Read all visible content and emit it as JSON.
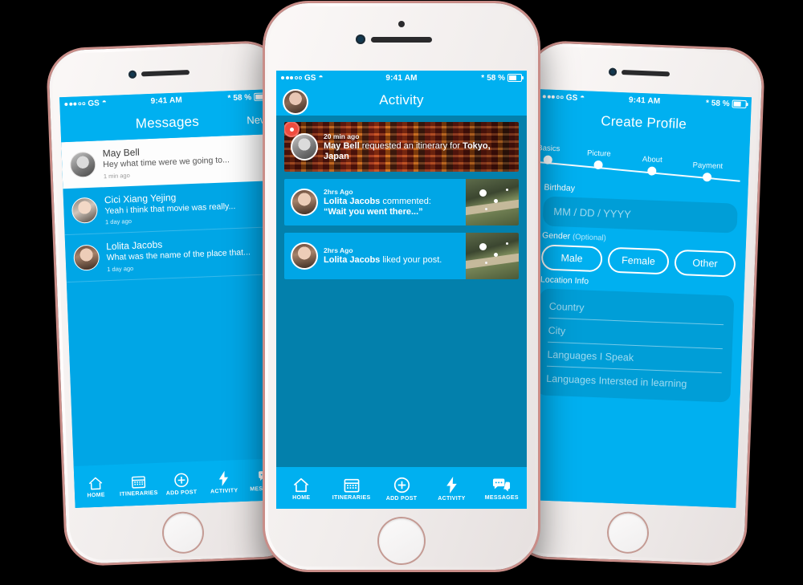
{
  "app": {
    "accent_blue": "#00B0F0",
    "body_blue": "#0380AC",
    "card_blue": "#00A6E6",
    "notification_red": "#F04B3E",
    "phone_body": "#F4F0EF",
    "phone_edge": "#C98D88",
    "page_background": "#000000"
  },
  "status_bar": {
    "carrier": "GS",
    "time": "9:41 AM",
    "battery": "58 %",
    "wifi_icon": "wifi-icon",
    "bluetooth_icon": "bluetooth-icon",
    "signal_icon": "signal-dots-icon",
    "battery_icon": "battery-icon"
  },
  "left_phone": {
    "screen_name": "Messages",
    "header": {
      "title": "Messages",
      "action": "New"
    },
    "conversations": [
      {
        "name": "May Bell",
        "preview": "Hey what time were we going to...",
        "time": "1 min ago",
        "unread": true
      },
      {
        "name": "Cici Xiang Yejing",
        "preview": "Yeah i think that movie was really...",
        "time": "1 day ago",
        "unread": false
      },
      {
        "name": "Lolita Jacobs",
        "preview": "What was the name of the place that...",
        "time": "1 day ago",
        "unread": false
      }
    ],
    "tabs": [
      {
        "label": "HOME",
        "icon": "home-icon"
      },
      {
        "label": "ITINERARIES",
        "icon": "calendar-icon"
      },
      {
        "label": "ADD POST",
        "icon": "plus-circle-icon"
      },
      {
        "label": "ACTIVITY",
        "icon": "lightning-bolt-icon"
      },
      {
        "label": "MESSAGES",
        "icon": "chat-bubble-icon"
      }
    ]
  },
  "center_phone": {
    "screen_name": "Activity",
    "header": {
      "title": "Activity",
      "avatar": "user-avatar"
    },
    "feed": [
      {
        "time": "20 min ago",
        "actor": "May Bell",
        "action": " requested an itinerary for ",
        "target": "Tokyo, Japan",
        "has_unread_badge": true,
        "style": "hero",
        "background_image": "tokyo-street-photo"
      },
      {
        "time": "2hrs Ago",
        "actor": "Lolita Jacobs",
        "action": " commented:",
        "quote": "“Wait you went there...”",
        "style": "plain",
        "thumbnail": "landscape-photo"
      },
      {
        "time": "2hrs Ago",
        "actor": "Lolita Jacobs",
        "action": " liked your post.",
        "style": "plain",
        "thumbnail": "landscape-photo"
      }
    ],
    "tabs": [
      {
        "label": "HOME",
        "icon": "home-icon"
      },
      {
        "label": "ITINERARIES",
        "icon": "calendar-icon"
      },
      {
        "label": "ADD POST",
        "icon": "plus-circle-icon"
      },
      {
        "label": "ACTIVITY",
        "icon": "lightning-bolt-icon"
      },
      {
        "label": "MESSAGES",
        "icon": "chat-bubble-icon"
      }
    ]
  },
  "right_phone": {
    "screen_name": "Create Profile",
    "header": {
      "title": "Create Profile"
    },
    "steps": [
      {
        "label": "Basics"
      },
      {
        "label": "Picture"
      },
      {
        "label": "About"
      },
      {
        "label": "Payment"
      }
    ],
    "birthday": {
      "label": "Birthday",
      "placeholder": "MM / DD / YYYY"
    },
    "gender": {
      "label": "Gender",
      "optional": "(Optional)",
      "options": [
        "Male",
        "Female",
        "Other"
      ]
    },
    "location": {
      "label": "Location Info",
      "fields": [
        "Country",
        "City",
        "Languages I Speak",
        "Languages Intersted in learning"
      ]
    }
  }
}
